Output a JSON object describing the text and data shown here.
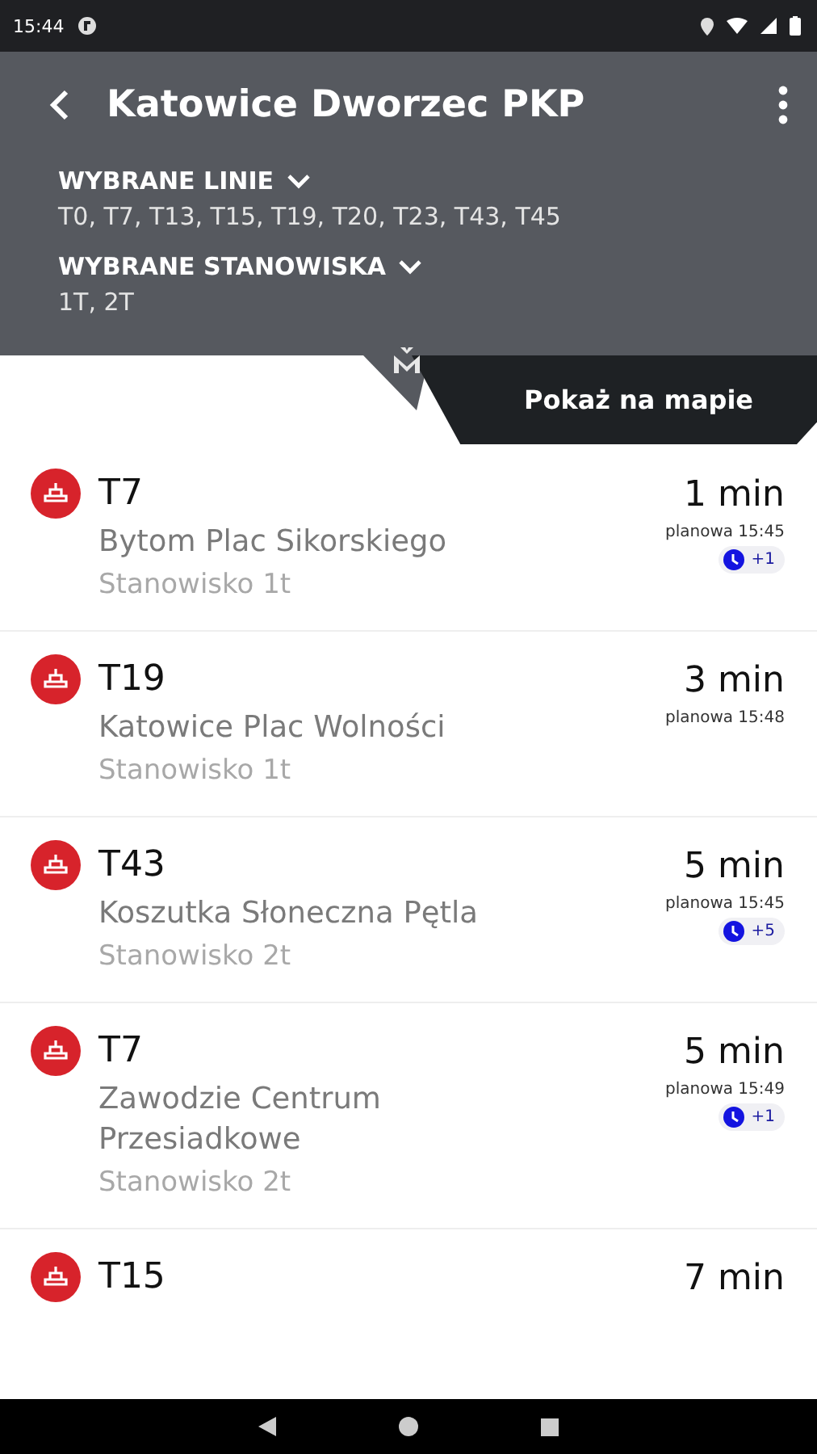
{
  "status_bar": {
    "time": "15:44"
  },
  "header": {
    "title": "Katowice Dworzec PKP",
    "filters": [
      {
        "label": "WYBRANE LINIE",
        "value": "T0, T7, T13, T15, T19, T20, T23, T43, T45",
        "expanded": false
      },
      {
        "label": "WYBRANE STANOWISKA",
        "value": "1T, 2T",
        "expanded": false
      }
    ],
    "map_button": "Pokaż na mapie"
  },
  "departures": [
    {
      "line": "T7",
      "destination": "Bytom Plac Sikorskiego",
      "platform": "Stanowisko 1t",
      "minutes": "1 min",
      "scheduled": "planowa 15:45",
      "delay": "+1"
    },
    {
      "line": "T19",
      "destination": "Katowice Plac Wolności",
      "platform": "Stanowisko 1t",
      "minutes": "3 min",
      "scheduled": "planowa 15:48"
    },
    {
      "line": "T43",
      "destination": "Koszutka Słoneczna Pętla",
      "platform": "Stanowisko 2t",
      "minutes": "5 min",
      "scheduled": "planowa 15:45",
      "delay": "+5"
    },
    {
      "line": "T7",
      "destination": "Zawodzie Centrum Przesiadkowe",
      "platform": "Stanowisko 2t",
      "minutes": "5 min",
      "scheduled": "planowa 15:49",
      "delay": "+1"
    },
    {
      "line": "T15",
      "minutes": "7 min"
    }
  ]
}
